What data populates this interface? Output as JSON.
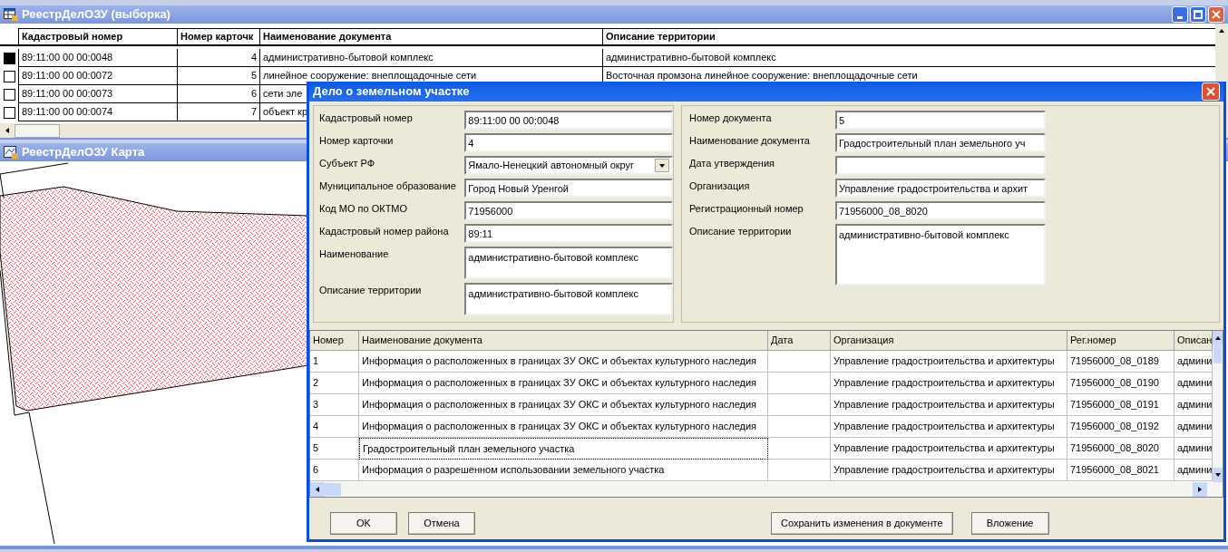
{
  "main_window": {
    "title": "РеестрДелОЗУ (выборка)",
    "columns": [
      "Кадастровый номер",
      "Номер карточк",
      "Наименование документа",
      "Описание территории"
    ],
    "rows": [
      {
        "selected": true,
        "cells": [
          "89:11:00 00 00:0048",
          "4",
          "административно-бытовой комплекс",
          "административно-бытовой комплекс"
        ]
      },
      {
        "selected": false,
        "cells": [
          "89:11:00 00 00:0072",
          "5",
          "линейное сооружение: внеплощадочные сети",
          "Восточная промзона линейное сооружение: внеплощадочные сети"
        ]
      },
      {
        "selected": false,
        "cells": [
          "89:11:00 00 00:0073",
          "6",
          "сети эле"
        ]
      },
      {
        "selected": false,
        "cells": [
          "89:11:00 00 00:0074",
          "7",
          "объект кр"
        ]
      }
    ]
  },
  "map_window": {
    "title": "РеестрДелОЗУ Карта"
  },
  "dialog": {
    "title": "Дело о земельном участке",
    "left_fields": [
      {
        "kind": "text",
        "label": "Кадастровый номер",
        "value": "89:11:00 00 00:0048"
      },
      {
        "kind": "text",
        "label": "Номер карточки",
        "value": "4"
      },
      {
        "kind": "combo",
        "label": "Субъект РФ",
        "value": "Ямало-Ненецкий автономный округ"
      },
      {
        "kind": "text",
        "label": "Муниципальное образование",
        "value": "Город Новый Уренгой"
      },
      {
        "kind": "text",
        "label": "Код МО по ОКТМО",
        "value": "71956000"
      },
      {
        "kind": "text",
        "label": "Кадастровый номер района",
        "value": "89:11"
      },
      {
        "kind": "memo",
        "label": "Наименование",
        "value": "административно-бытовой комплекс"
      },
      {
        "kind": "memo",
        "label": "Описание территории",
        "value": "административно-бытовой комплекс"
      }
    ],
    "right_fields": [
      {
        "kind": "text",
        "label": "Номер документа",
        "value": "5"
      },
      {
        "kind": "text",
        "label": "Наименование документа",
        "value": "Градостроительный план земельного уч"
      },
      {
        "kind": "text",
        "label": "Дата утверждения"
      },
      {
        "kind": "text",
        "label": "Организация",
        "value": "Управление градостроительства и архит"
      },
      {
        "kind": "text",
        "label": "Регистрационный номер",
        "value": "71956000_08_8020"
      },
      {
        "kind": "bigmemo",
        "label": "Описание территории",
        "value": "административно-бытовой комплекс"
      }
    ],
    "grid": {
      "columns": [
        "Номер",
        "Наименование документа",
        "Дата",
        "Организация",
        "Рег.номер",
        "Описан"
      ],
      "rows": [
        {
          "focused": false,
          "cells": [
            "1",
            "Информация о расположенных в границах ЗУ ОКС и объектах культурного наследия",
            null,
            "Управление градостроительства и архитектуры",
            "71956000_08_0189",
            "админи"
          ]
        },
        {
          "focused": false,
          "cells": [
            "2",
            "Информация о расположенных в границах ЗУ ОКС и объектах культурного наследия",
            null,
            "Управление градостроительства и архитектуры",
            "71956000_08_0190",
            "админи"
          ]
        },
        {
          "focused": false,
          "cells": [
            "3",
            "Информация о расположенных в границах ЗУ ОКС и объектах культурного наследия",
            null,
            "Управление градостроительства и архитектуры",
            "71956000_08_0191",
            "админи"
          ]
        },
        {
          "focused": false,
          "cells": [
            "4",
            "Информация о расположенных в границах ЗУ ОКС и объектах культурного наследия",
            null,
            "Управление градостроительства и архитектуры",
            "71956000_08_0192",
            "админи"
          ]
        },
        {
          "focused": true,
          "cells": [
            "5",
            "Градостроительный план земельного участка",
            null,
            "Управление градостроительства и архитектуры",
            "71956000_08_8020",
            "админи"
          ]
        },
        {
          "focused": false,
          "cells": [
            "6",
            "Информация о разрешенном использовании земельного участка",
            null,
            "Управление градостроительства и архитектуры",
            "71956000_08_8021",
            "админи"
          ]
        }
      ]
    },
    "buttons": [
      "OK",
      "Отмена",
      "Сохранить изменения в документе",
      "Вложение"
    ]
  }
}
